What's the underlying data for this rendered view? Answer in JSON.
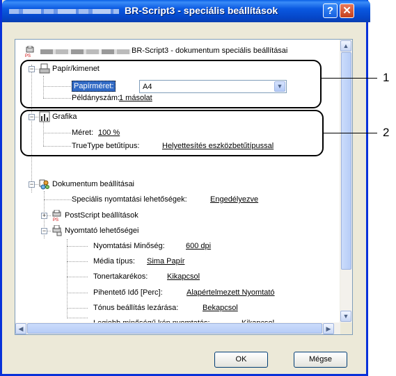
{
  "window": {
    "title": "BR-Script3 - speciális beállítások",
    "help_label": "?",
    "close_label": "✕"
  },
  "tree": {
    "root_label": "BR-Script3 - dokumentum speciális beállításai",
    "paper_output": {
      "label": "Papír/kimenet",
      "paper_size_label": "Papírméret:",
      "paper_size_value": "A4",
      "copies_label": "Példányszám:",
      "copies_value": "1 másolat"
    },
    "graphics": {
      "label": "Grafika",
      "scale_label": "Méret:",
      "scale_value": "100 %",
      "truetype_label": "TrueType betűtípus:",
      "truetype_value": "Helyettesítés eszközbetűtípussal"
    },
    "document_options": {
      "label": "Dokumentum beállításai",
      "advanced_print_label": "Speciális nyomtatási lehetőségek:",
      "advanced_print_value": "Engedélyezve",
      "postscript_label": "PostScript beállítások",
      "printer_features": {
        "label": "Nyomtató lehetőségei",
        "items": [
          {
            "label": "Nyomtatási Minőség:",
            "value": "600 dpi"
          },
          {
            "label": "Média típus:",
            "value": "Sima Papír"
          },
          {
            "label": "Tonertakarékos:",
            "value": "Kikapcsol"
          },
          {
            "label": "Pihentető Idő [Perc]:",
            "value": "Alapértelmezett Nyomtató"
          },
          {
            "label": "Tónus beállítás lezárása:",
            "value": "Bekapcsol"
          },
          {
            "label": "Legjobb minőségű kép nyomtatás:",
            "value": "Kikapcsol"
          }
        ]
      }
    }
  },
  "callouts": {
    "one": "1",
    "two": "2"
  },
  "buttons": {
    "ok": "OK",
    "cancel": "Mégse"
  },
  "scroll": {
    "up": "▲",
    "down": "▼",
    "left": "◀",
    "right": "▶",
    "dropdown": "▼"
  },
  "colors": {
    "title_bar": "#0A58E0",
    "selection": "#316AC5",
    "dialog_bg": "#ECE9D8"
  }
}
